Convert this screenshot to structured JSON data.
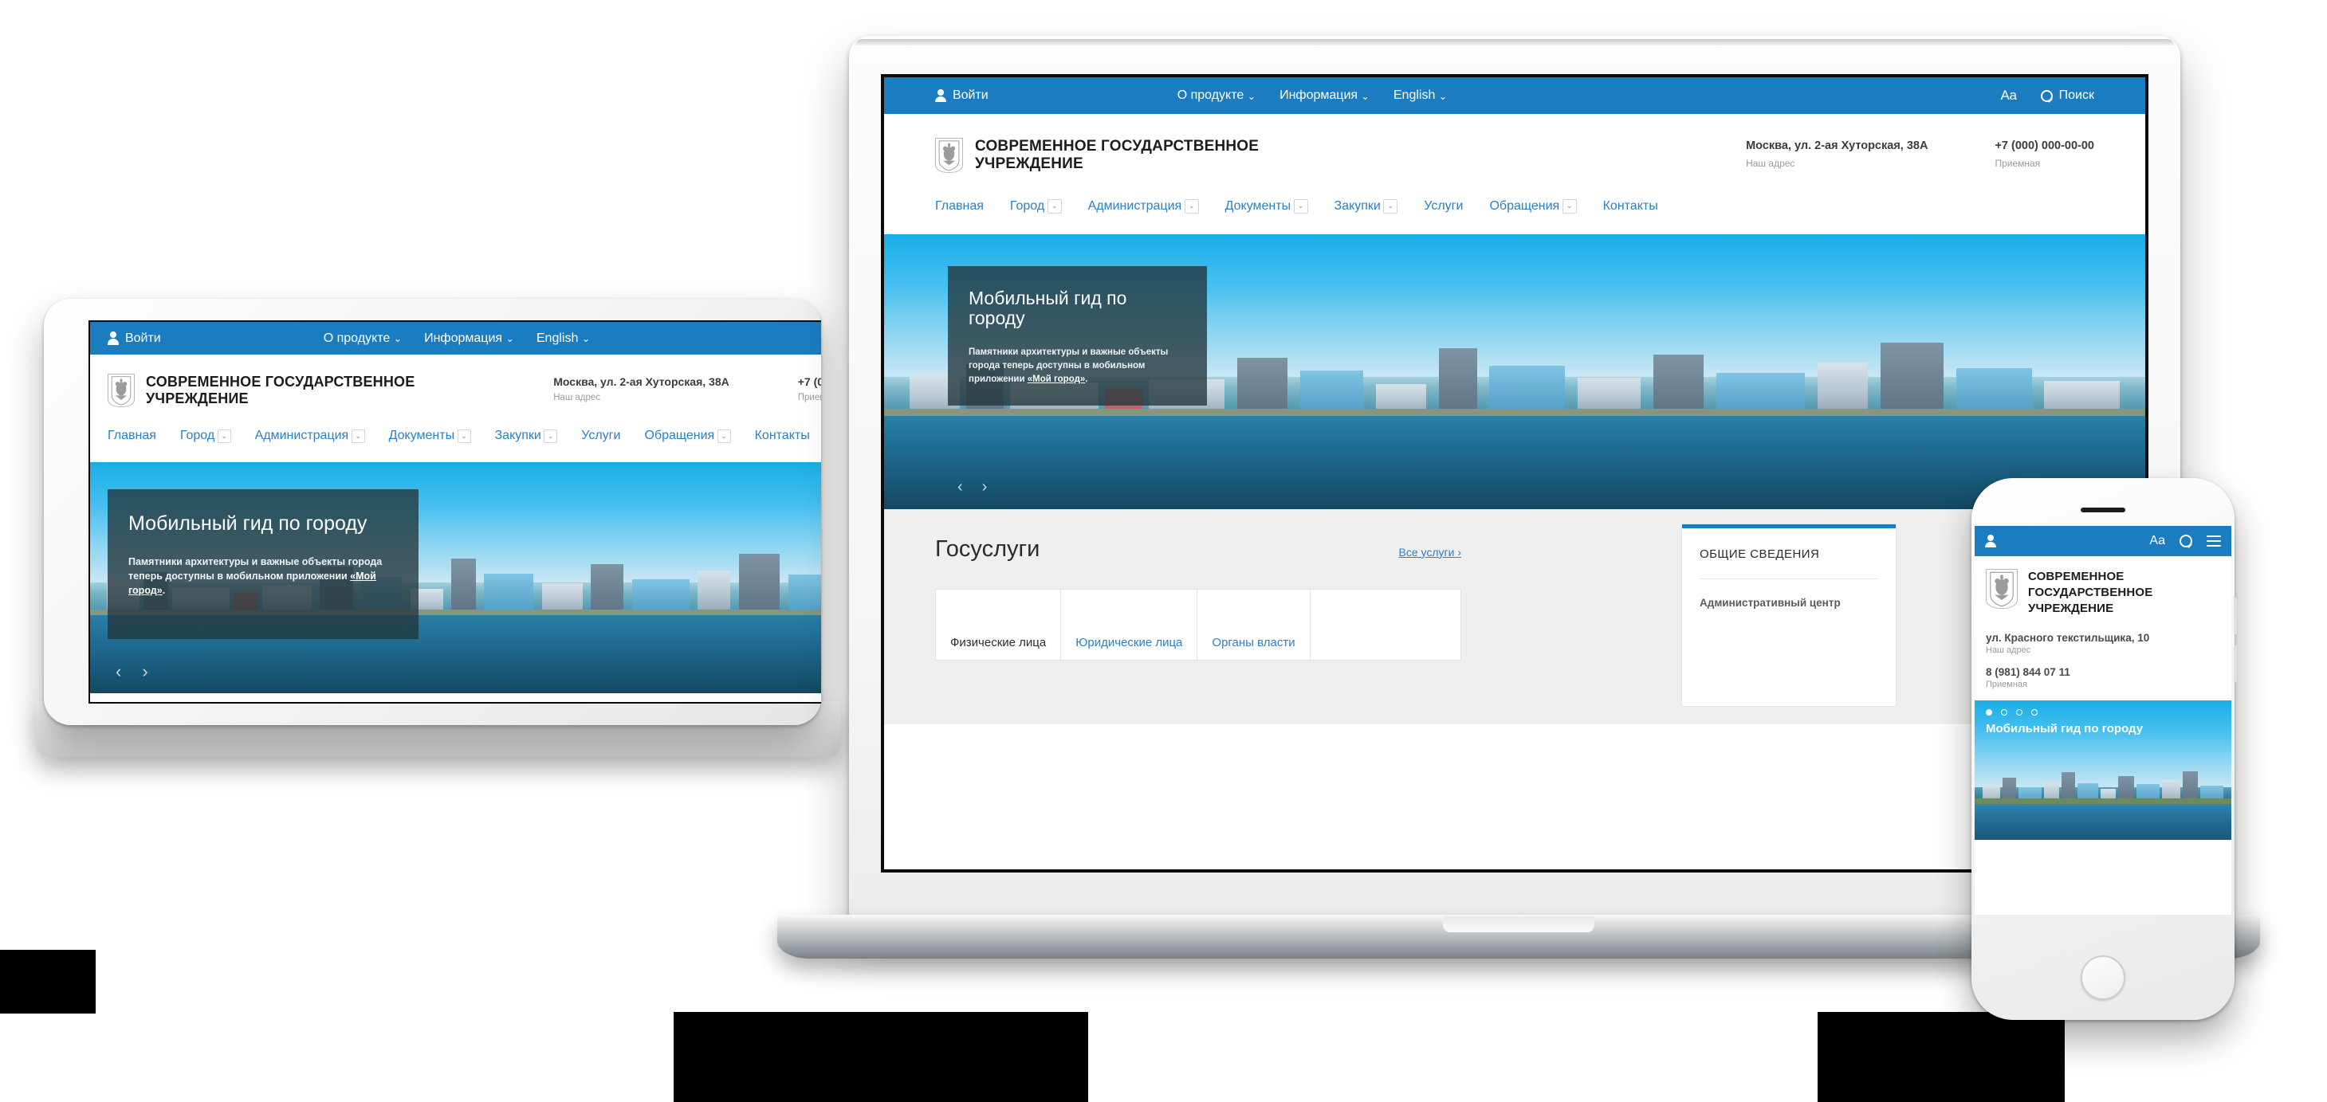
{
  "site": {
    "topbar": {
      "login_label": "Войти",
      "login_icon": "person-icon",
      "menu": [
        {
          "label": "О продукте",
          "has_caret": true
        },
        {
          "label": "Информация",
          "has_caret": true
        },
        {
          "label": "English",
          "has_caret": true
        }
      ],
      "font_size_label": "Aa",
      "font_size_icon": "font-size-icon",
      "search_label": "Поиск",
      "search_icon": "search-icon"
    },
    "brand": {
      "crest_icon": "coat-of-arms-icon",
      "name_line1": "СОВРЕМЕННОЕ ГОСУДАРСТВЕННОЕ",
      "name_line2": "УЧРЕЖДЕНИЕ",
      "name_full": "СОВРЕМЕННОЕ ГОСУДАРСТВЕННОЕ УЧРЕЖДЕНИЕ"
    },
    "contacts": [
      {
        "value": "Москва, ул. 2-ая Хуторская, 38А",
        "label": "Наш адрес"
      },
      {
        "value": "+7 (000) 000-00-00",
        "label": "Приемная"
      }
    ],
    "nav": [
      {
        "label": "Главная",
        "has_caret": false,
        "active": true
      },
      {
        "label": "Город",
        "has_caret": true
      },
      {
        "label": "Администрация",
        "has_caret": true
      },
      {
        "label": "Документы",
        "has_caret": true
      },
      {
        "label": "Закупки",
        "has_caret": true
      },
      {
        "label": "Услуги",
        "has_caret": false
      },
      {
        "label": "Обращения",
        "has_caret": true
      },
      {
        "label": "Контакты",
        "has_caret": false
      }
    ],
    "hero": {
      "title": "Мобильный гид по городу",
      "text_before": "Памятники архитектуры и важные объекты города теперь доступны в мобильном приложении ",
      "link": "«Мой город»",
      "text_after": ".",
      "prev_icon": "chevron-left-icon",
      "prev_glyph": "‹",
      "next_icon": "chevron-right-icon",
      "next_glyph": "›",
      "dots": 4,
      "active_dot": 0
    },
    "services": {
      "title": "Госуслуги",
      "all_link": "Все услуги",
      "all_link_glyph": "›",
      "tabs": [
        {
          "label": "Физические лица",
          "active": true
        },
        {
          "label": "Юридические лица",
          "active": false
        },
        {
          "label": "Органы власти",
          "active": false
        }
      ]
    },
    "sidecard": {
      "title": "ОБЩИЕ СВЕДЕНИЯ",
      "row_label": "Административный центр"
    }
  },
  "phone": {
    "topbar": {
      "login_icon": "person-icon",
      "font_size_label": "Aa",
      "search_icon": "search-icon",
      "menu_icon": "hamburger-menu-icon"
    },
    "brand": {
      "crest_icon": "coat-of-arms-icon",
      "line1": "СОВРЕМЕННОЕ",
      "line2": "ГОСУДАРСТВЕННОЕ",
      "line3": "УЧРЕЖДЕНИЕ"
    },
    "contacts": [
      {
        "value": "ул. Красного текстильщика, 10",
        "label": "Наш адрес"
      },
      {
        "value": "8 (981) 844 07 11",
        "label": "Приемная"
      }
    ],
    "hero": {
      "title": "Мобильный гид по городу",
      "dots": 4,
      "active_dot": 0
    }
  },
  "colors": {
    "brand_blue": "#1b7cc0",
    "link_blue": "#2d7fc1",
    "hero_overlay": "rgba(34,52,58,.78)",
    "services_bg": "#efefef",
    "text_dark": "#1c1c1c",
    "text_muted": "#9a9a9a"
  }
}
